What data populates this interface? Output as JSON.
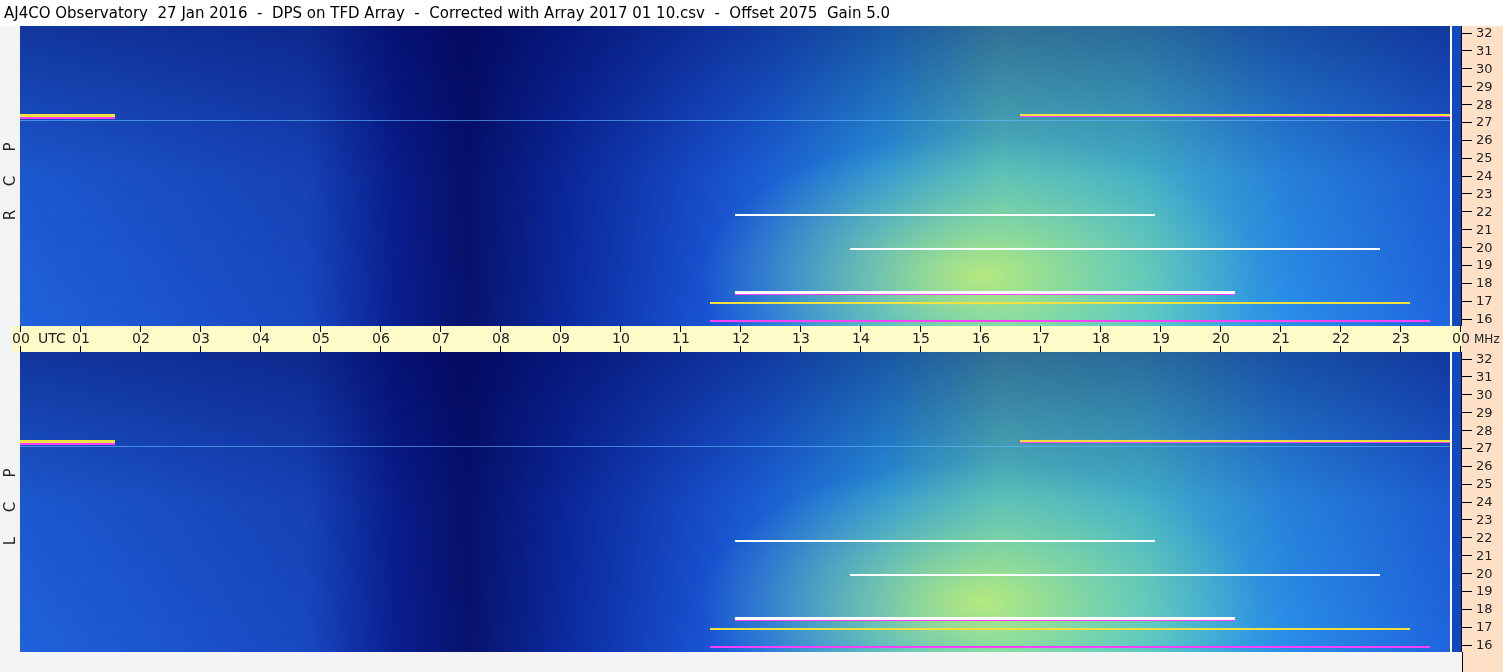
{
  "window": {
    "title": "AJ4CO Observatory  27 Jan 2016  -  DPS on TFD Array  -  Corrected with Array 2017 01 10.csv  -  Offset 2075  Gain 5.0"
  },
  "panels": [
    {
      "letters": [
        "R",
        "C",
        "P"
      ],
      "frequency_ticks": [
        "32",
        "31",
        "30",
        "29",
        "28",
        "27",
        "26",
        "25",
        "24",
        "23",
        "22",
        "21",
        "20",
        "19",
        "18",
        "17",
        "16"
      ]
    },
    {
      "letters": [
        "L",
        "C",
        "P"
      ],
      "frequency_ticks": [
        "32",
        "31",
        "30",
        "29",
        "28",
        "27",
        "26",
        "25",
        "24",
        "23",
        "22",
        "21",
        "20",
        "19",
        "18",
        "17",
        "16"
      ]
    }
  ],
  "time_axis": {
    "labels": [
      "00",
      "01",
      "02",
      "03",
      "04",
      "05",
      "06",
      "07",
      "08",
      "09",
      "10",
      "11",
      "12",
      "13",
      "14",
      "15",
      "16",
      "17",
      "18",
      "19",
      "20",
      "21",
      "22",
      "23",
      "00"
    ],
    "time_unit": "UTC",
    "frequency_unit": "MHz"
  }
}
